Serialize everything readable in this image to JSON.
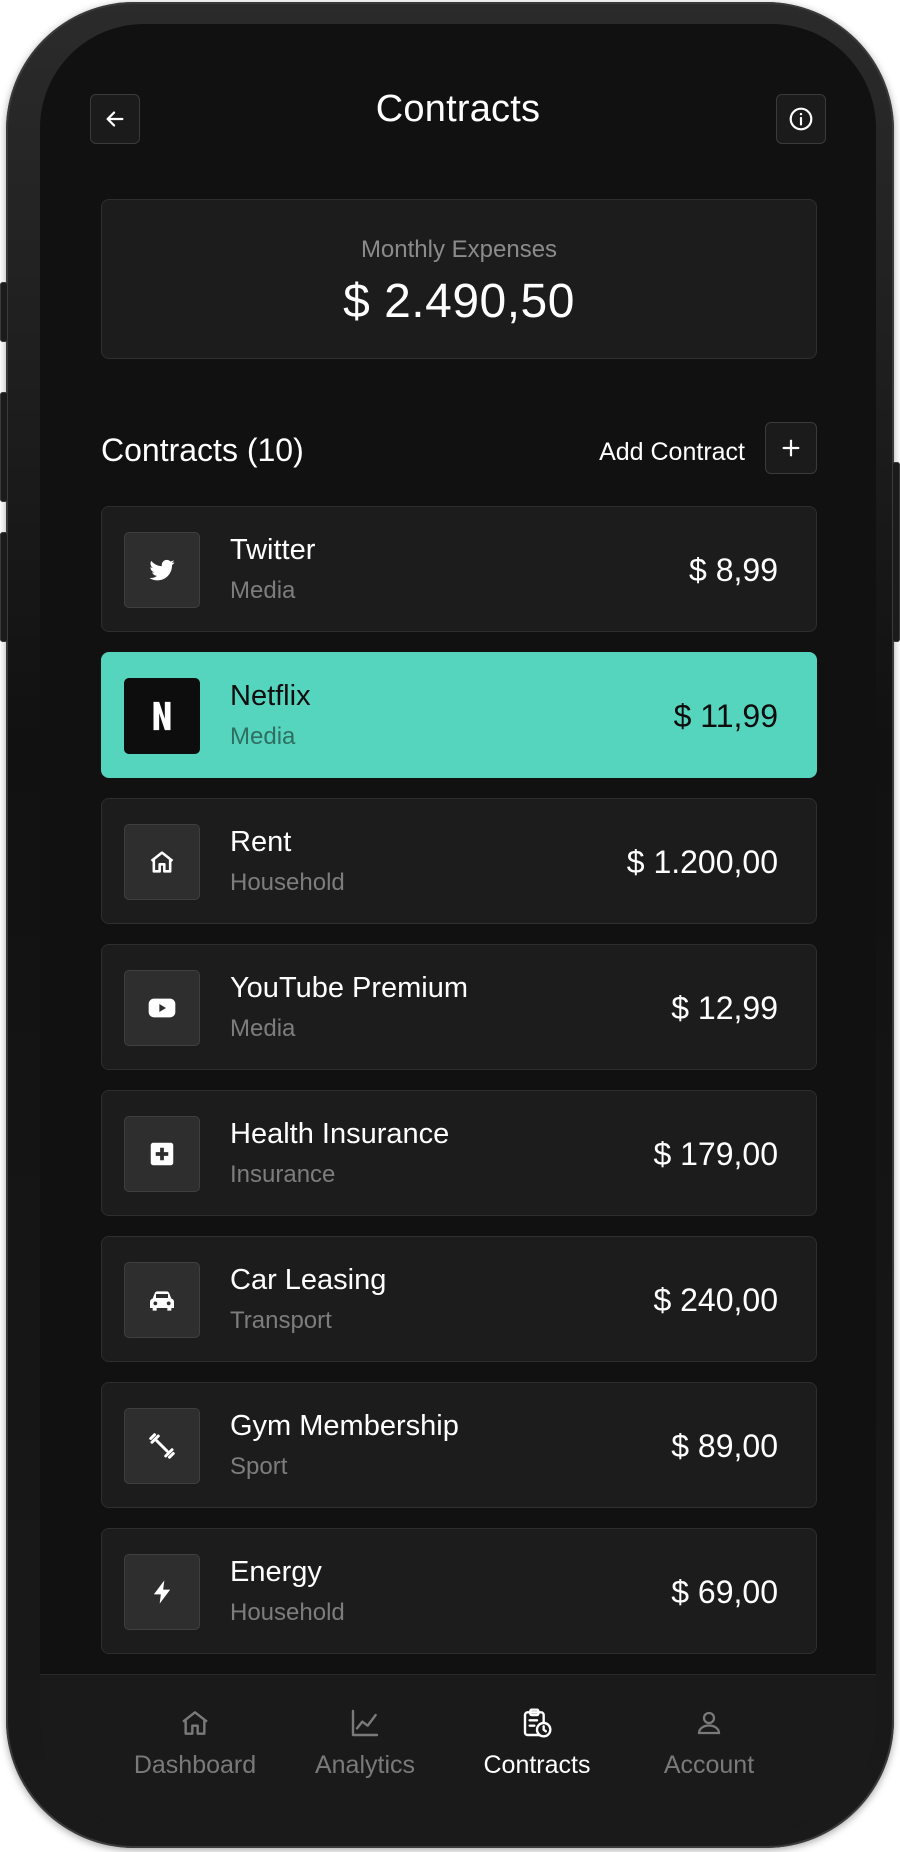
{
  "header": {
    "title": "Contracts",
    "back_icon": "arrow-left-icon",
    "info_icon": "info-icon"
  },
  "summary": {
    "label": "Monthly Expenses",
    "value": "$ 2.490,50"
  },
  "contracts_section": {
    "title": "Contracts (10)",
    "add_label": "Add Contract",
    "add_icon": "plus-icon"
  },
  "contracts": [
    {
      "name": "Twitter",
      "category": "Media",
      "price": "$ 8,99",
      "icon": "twitter-icon",
      "active": false
    },
    {
      "name": "Netflix",
      "category": "Media",
      "price": "$ 11,99",
      "icon": "netflix-icon",
      "active": true
    },
    {
      "name": "Rent",
      "category": "Household",
      "price": "$ 1.200,00",
      "icon": "home-icon",
      "active": false
    },
    {
      "name": "YouTube Premium",
      "category": "Media",
      "price": "$ 12,99",
      "icon": "youtube-icon",
      "active": false
    },
    {
      "name": "Health Insurance",
      "category": "Insurance",
      "price": "$ 179,00",
      "icon": "medical-plus-icon",
      "active": false
    },
    {
      "name": "Car Leasing",
      "category": "Transport",
      "price": "$ 240,00",
      "icon": "car-icon",
      "active": false
    },
    {
      "name": "Gym Membership",
      "category": "Sport",
      "price": "$ 89,00",
      "icon": "dumbbell-icon",
      "active": false
    },
    {
      "name": "Energy",
      "category": "Household",
      "price": "$ 69,00",
      "icon": "lightning-icon",
      "active": false
    }
  ],
  "tabbar": {
    "items": [
      {
        "label": "Dashboard",
        "icon": "home-icon",
        "active": false
      },
      {
        "label": "Analytics",
        "icon": "chart-line-icon",
        "active": false
      },
      {
        "label": "Contracts",
        "icon": "contracts-clock-icon",
        "active": true
      },
      {
        "label": "Account",
        "icon": "user-icon",
        "active": false
      }
    ]
  },
  "colors": {
    "accent": "#56d5be",
    "background": "#111111",
    "card": "#1c1c1c",
    "text_primary": "#ffffff",
    "text_secondary": "#7d7d7d"
  }
}
